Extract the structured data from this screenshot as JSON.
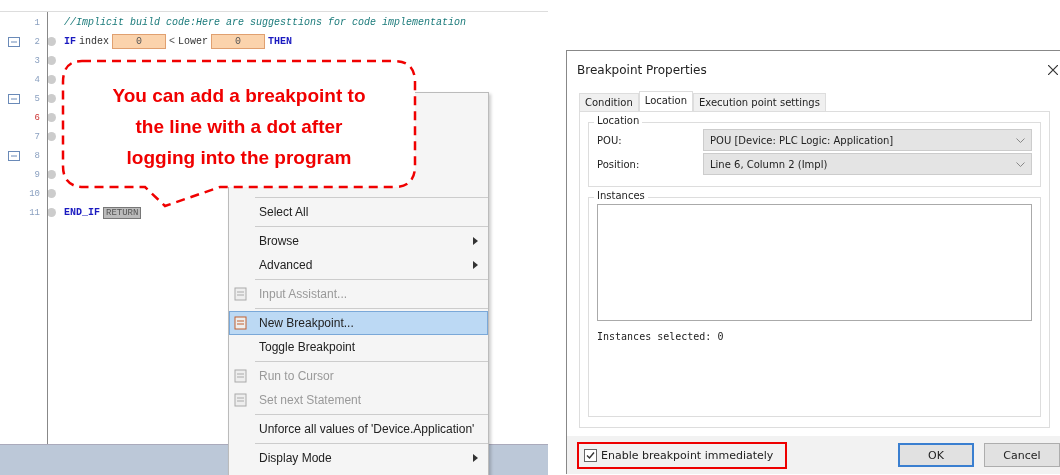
{
  "editor": {
    "lines": [
      {
        "number": "1",
        "fold": false,
        "dot": false,
        "current": false,
        "tokens": [
          {
            "kind": "comment",
            "text": "//Implicit build code:Here are suggesttions for code implementation"
          }
        ]
      },
      {
        "number": "2",
        "fold": true,
        "dot": true,
        "current": false,
        "tokens": [
          {
            "kind": "keyword",
            "text": "IF"
          },
          {
            "kind": "ident",
            "text": "index"
          },
          {
            "kind": "value",
            "text": "0"
          },
          {
            "kind": "op",
            "text": "<"
          },
          {
            "kind": "ident",
            "text": "Lower"
          },
          {
            "kind": "value",
            "text": "0"
          },
          {
            "kind": "keyword",
            "text": "THEN"
          }
        ]
      },
      {
        "number": "3",
        "fold": false,
        "dot": true,
        "current": false
      },
      {
        "number": "4",
        "fold": false,
        "dot": true,
        "current": false
      },
      {
        "number": "5",
        "fold": true,
        "dot": true,
        "current": false
      },
      {
        "number": "6",
        "fold": false,
        "dot": true,
        "current": true
      },
      {
        "number": "7",
        "fold": false,
        "dot": true,
        "current": false
      },
      {
        "number": "8",
        "fold": true,
        "dot": false,
        "current": false
      },
      {
        "number": "9",
        "fold": false,
        "dot": true,
        "current": false
      },
      {
        "number": "10",
        "fold": false,
        "dot": true,
        "current": false
      },
      {
        "number": "11",
        "fold": false,
        "dot": true,
        "current": false,
        "tokens": [
          {
            "kind": "keyword",
            "text": "END_IF"
          },
          {
            "kind": "return",
            "text": "RETURN"
          }
        ]
      }
    ]
  },
  "callout": {
    "text": "You can add a breakpoint to the line with a dot after logging into the program"
  },
  "context_menu": {
    "items": [
      {
        "kind": "separator"
      },
      {
        "kind": "item",
        "label": "Select All",
        "disabled": false,
        "selected": false,
        "submenu": false,
        "icon": false
      },
      {
        "kind": "separator"
      },
      {
        "kind": "item",
        "label": "Browse",
        "disabled": false,
        "selected": false,
        "submenu": true,
        "icon": false
      },
      {
        "kind": "item",
        "label": "Advanced",
        "disabled": false,
        "selected": false,
        "submenu": true,
        "icon": false
      },
      {
        "kind": "separator"
      },
      {
        "kind": "item",
        "label": "Input Assistant...",
        "disabled": true,
        "selected": false,
        "submenu": false,
        "icon": true
      },
      {
        "kind": "separator"
      },
      {
        "kind": "item",
        "label": "New Breakpoint...",
        "disabled": false,
        "selected": true,
        "submenu": false,
        "icon": true
      },
      {
        "kind": "item",
        "label": "Toggle Breakpoint",
        "disabled": false,
        "selected": false,
        "submenu": false,
        "icon": false
      },
      {
        "kind": "separator"
      },
      {
        "kind": "item",
        "label": "Run to Cursor",
        "disabled": true,
        "selected": false,
        "submenu": false,
        "icon": true
      },
      {
        "kind": "item",
        "label": "Set next Statement",
        "disabled": true,
        "selected": false,
        "submenu": false,
        "icon": true
      },
      {
        "kind": "separator"
      },
      {
        "kind": "item",
        "label": "Unforce all values of 'Device.Application'",
        "disabled": false,
        "selected": false,
        "submenu": false,
        "icon": false
      },
      {
        "kind": "separator"
      },
      {
        "kind": "item",
        "label": "Display Mode",
        "disabled": false,
        "selected": false,
        "submenu": true,
        "icon": false
      }
    ]
  },
  "dialog": {
    "title": "Breakpoint Properties",
    "tabs": [
      {
        "label": "Condition",
        "selected": false
      },
      {
        "label": "Location",
        "selected": true
      },
      {
        "label": "Execution point settings",
        "selected": false
      }
    ],
    "location": {
      "legend": "Location",
      "fields": [
        {
          "label": "POU:",
          "value": "POU [Device: PLC Logic: Application]"
        },
        {
          "label": "Position:",
          "value": "Line 6, Column 2 (Impl)"
        }
      ]
    },
    "instances": {
      "legend": "Instances",
      "status": "Instances selected: 0"
    },
    "enable_checkbox": {
      "label": "Enable breakpoint immediately",
      "checked": true,
      "highlighted": true
    },
    "buttons": [
      {
        "label": "OK",
        "default": true
      },
      {
        "label": "Cancel",
        "default": false
      }
    ]
  }
}
